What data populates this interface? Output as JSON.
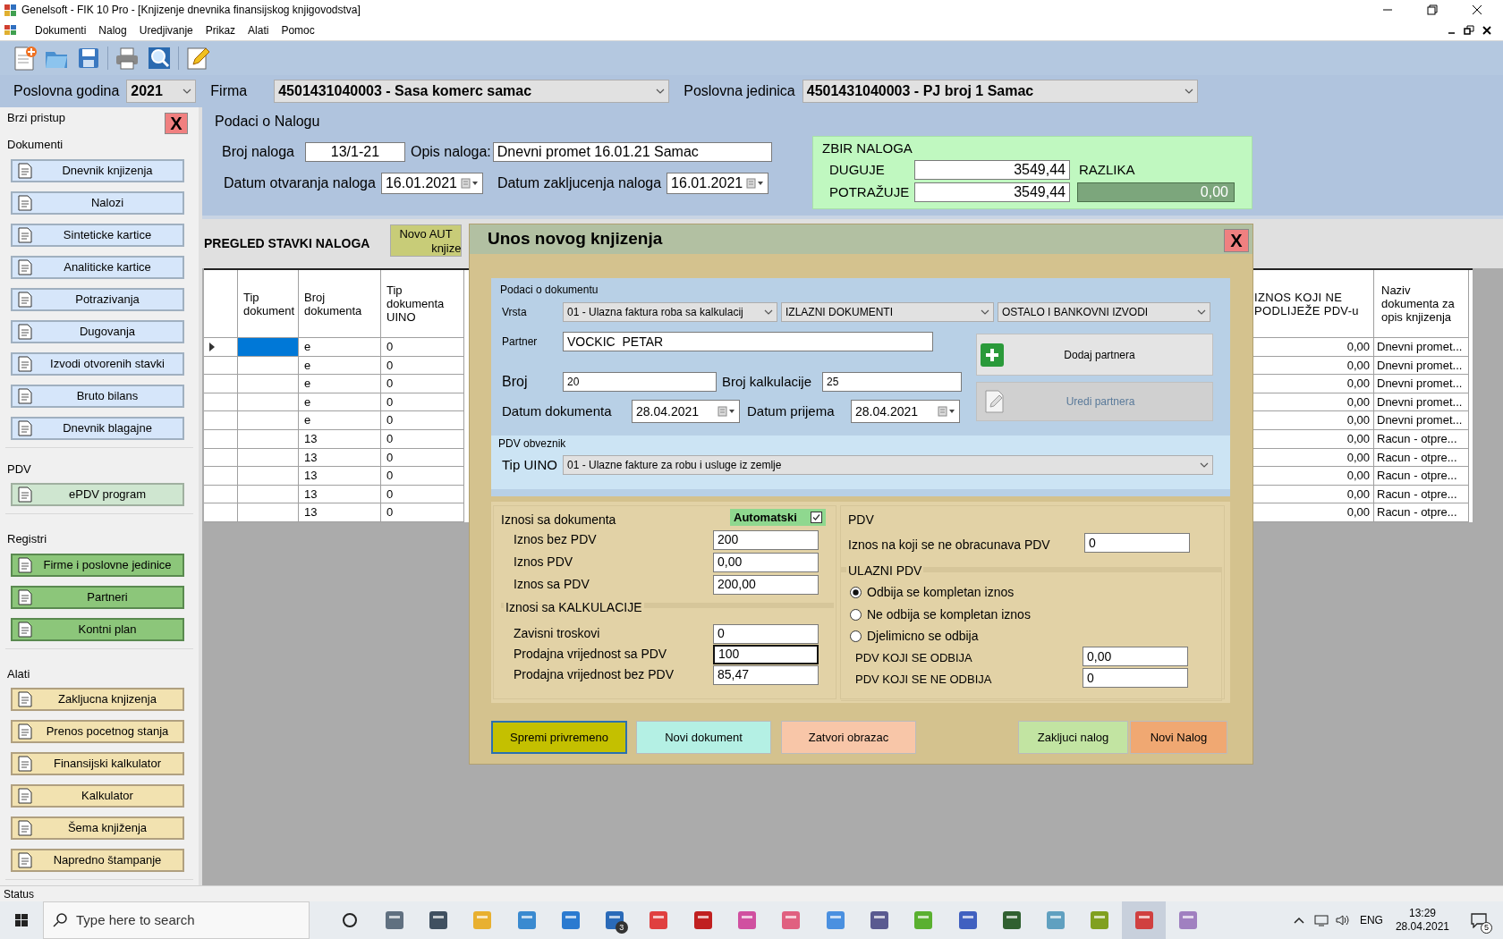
{
  "window": {
    "title": "Genelsoft - FIK 10 Pro - [Knjizenje dnevnika finansijskog knjigovodstva]"
  },
  "menu": [
    "Dokumenti",
    "Nalog",
    "Uredjivanje",
    "Prikaz",
    "Alati",
    "Pomoc"
  ],
  "header": {
    "year_label": "Poslovna godina",
    "year": "2021",
    "firm_label": "Firma",
    "firm": "4501431040003 - Sasa komerc samac",
    "unit_label": "Poslovna jedinica",
    "unit": "4501431040003 - PJ broj 1 Samac"
  },
  "sidebar": {
    "title": "Brzi pristup",
    "close": "X",
    "groups": [
      {
        "title": "Dokumenti",
        "kind": "documents",
        "items": [
          "Dnevnik knjizenja",
          "Nalozi",
          "Sinteticke kartice",
          "Analiticke kartice",
          "Potrazivanja",
          "Dugovanja",
          "Izvodi otvorenih stavki",
          "Bruto bilans",
          "Dnevnik blagajne"
        ]
      },
      {
        "title": "PDV",
        "kind": "pdv",
        "items": [
          "ePDV program"
        ]
      },
      {
        "title": "Registri",
        "kind": "registers",
        "items": [
          "Firme i poslovne jedinice",
          "Partneri",
          "Kontni plan"
        ]
      },
      {
        "title": "Alati",
        "kind": "tools",
        "items": [
          "Zakljucna knjizenja",
          "Prenos pocetnog stanja",
          "Finansijski kalkulator",
          "Kalkulator",
          "Šema knjiženja",
          "Napredno štampanje"
        ]
      }
    ]
  },
  "order": {
    "title": "Podaci o Nalogu",
    "number_label": "Broj naloga",
    "number": "13/1-21",
    "description_label": "Opis naloga:",
    "description": "Dnevni promet 16.01.21 Samac",
    "open_date_label": "Datum otvaranja naloga",
    "open_date": "16.01.2021",
    "close_date_label": "Datum zakljucenja naloga",
    "close_date": "16.01.2021",
    "totals": {
      "title": "ZBIR NALOGA",
      "debit_label": "DUGUJE",
      "debit": "3549,44",
      "credit_label": "POTRAŽUJE",
      "credit": "3549,44",
      "difference_label": "RAZLIKA",
      "difference": "0,00"
    }
  },
  "items": {
    "title": "PREGLED STAVKI NALOGA",
    "auto_button": [
      "Novo AUT",
      "knjize"
    ],
    "left_columns": [
      "Tip dokument",
      "Broj dokumenta",
      "Tip dokumenta UINO"
    ],
    "right_columns": [
      "IZNOS KOJI NE PODLIJEŽE PDV-u",
      "Naziv dokumenta za opis knjizenja"
    ],
    "rows": [
      {
        "selected": true,
        "doc_number": "e",
        "uino": "0",
        "exempt": "0,00",
        "name": "Dnevni promet..."
      },
      {
        "selected": false,
        "doc_number": "e",
        "uino": "0",
        "exempt": "0,00",
        "name": "Dnevni promet..."
      },
      {
        "selected": false,
        "doc_number": "e",
        "uino": "0",
        "exempt": "0,00",
        "name": "Dnevni promet..."
      },
      {
        "selected": false,
        "doc_number": "e",
        "uino": "0",
        "exempt": "0,00",
        "name": "Dnevni promet..."
      },
      {
        "selected": false,
        "doc_number": "e",
        "uino": "0",
        "exempt": "0,00",
        "name": "Dnevni promet..."
      },
      {
        "selected": false,
        "doc_number": "13",
        "uino": "0",
        "exempt": "0,00",
        "name": "Racun - otpre..."
      },
      {
        "selected": false,
        "doc_number": "13",
        "uino": "0",
        "exempt": "0,00",
        "name": "Racun - otpre..."
      },
      {
        "selected": false,
        "doc_number": "13",
        "uino": "0",
        "exempt": "0,00",
        "name": "Racun - otpre..."
      },
      {
        "selected": false,
        "doc_number": "13",
        "uino": "0",
        "exempt": "0,00",
        "name": "Racun - otpre..."
      },
      {
        "selected": false,
        "doc_number": "13",
        "uino": "0",
        "exempt": "0,00",
        "name": "Racun - otpre..."
      }
    ]
  },
  "dialog": {
    "title": "Unos novog knjizenja",
    "close": "X",
    "document": {
      "title": "Podaci o dokumentu",
      "type_label": "Vrsta",
      "type": "01 - Ulazna faktura roba sa kalkulacij",
      "group": "IZLAZNI DOKUMENTI",
      "subgroup": "OSTALO I BANKOVNI IZVODI",
      "partner_label": "Partner",
      "partner": "VOCKIC  PETAR",
      "add_partner": "Dodaj partnera",
      "edit_partner": {
        "label": "Uredi partnera",
        "disabled": true
      },
      "number_label": "Broj",
      "number": "20",
      "calc_label": "Broj kalkulacije",
      "calc": "25",
      "doc_date_label": "Datum dokumenta",
      "doc_date": "28.04.2021",
      "recv_date_label": "Datum prijema",
      "recv_date": "28.04.2021"
    },
    "vat_payer": {
      "title": "PDV obveznik",
      "uino_label": "Tip UINO",
      "uino": "01 - Ulazne fakture za robu i usluge iz zemlje"
    },
    "amounts": {
      "title": "Iznosi sa dokumenta",
      "auto_label": "Automatski",
      "auto_checked": true,
      "fields": [
        {
          "label": "Iznos bez PDV",
          "value": "200",
          "focused": false
        },
        {
          "label": "Iznos PDV",
          "value": "0,00",
          "focused": false
        },
        {
          "label": "Iznos sa PDV",
          "value": "200,00",
          "focused": false
        }
      ]
    },
    "calculation": {
      "title": "Iznosi sa KALKULACIJE",
      "fields": [
        {
          "label": "Zavisni troskovi",
          "value": "0",
          "focused": false
        },
        {
          "label": "Prodajna vrijednost sa PDV",
          "value": "100",
          "focused": true
        },
        {
          "label": "Prodajna vrijednost bez PDV",
          "value": "85,47",
          "focused": false
        }
      ]
    },
    "vat": {
      "title": "PDV",
      "exempt_label": "Iznos na koji se ne obracunava PDV",
      "exempt": "0",
      "input_title": "ULAZNI PDV",
      "options": [
        {
          "label": "Odbija se kompletan iznos",
          "selected": true
        },
        {
          "label": "Ne odbija se kompletan iznos",
          "selected": false
        },
        {
          "label": "Djelimicno se odbija",
          "selected": false
        }
      ],
      "fields": [
        {
          "label": "PDV KOJI SE ODBIJA",
          "value": "0,00"
        },
        {
          "label": "PDV KOJI SE NE ODBIJA",
          "value": "0"
        }
      ]
    },
    "buttons": [
      {
        "label": "Spremi privremeno",
        "kind": "save"
      },
      {
        "label": "Novi dokument",
        "kind": "new"
      },
      {
        "label": "Zatvori obrazac",
        "kind": "close"
      },
      {
        "label": "Zakljuci nalog",
        "kind": "finish"
      },
      {
        "label": "Novi Nalog",
        "kind": "order"
      }
    ]
  },
  "status_bar": "Status",
  "taskbar": {
    "search_placeholder": "Type here to search",
    "mail_badge": "3",
    "language": "ENG",
    "time": "13:29",
    "date": "28.04.2021",
    "notifications": "5"
  }
}
